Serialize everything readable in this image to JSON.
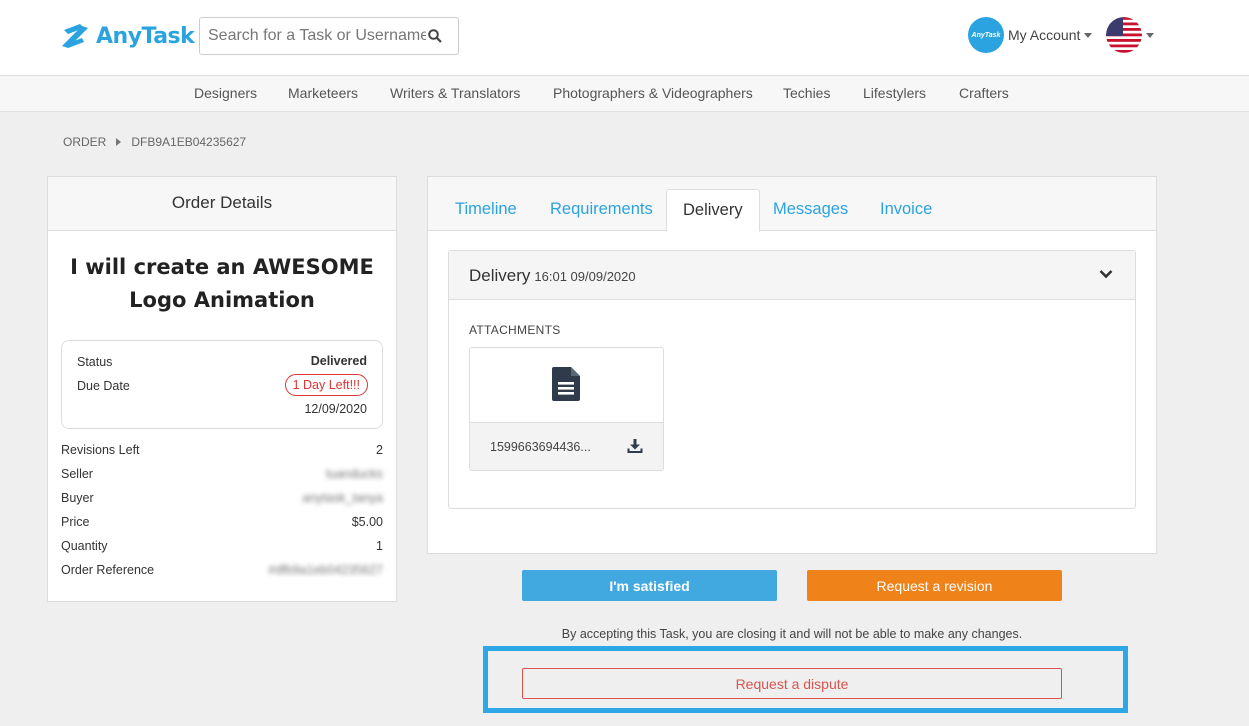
{
  "header": {
    "logo_text": "AnyTask",
    "search_placeholder": "Search for a Task or Username",
    "account_label": "My Account",
    "avatar_text": "AnyTask",
    "search_icon": "search-icon",
    "flag_icon": "us-flag-icon"
  },
  "categories": [
    "Designers",
    "Marketeers",
    "Writers & Translators",
    "Photographers & Videographers",
    "Techies",
    "Lifestylers",
    "Crafters"
  ],
  "breadcrumb": {
    "root": "ORDER",
    "current": "DFB9A1EB04235627"
  },
  "order_details": {
    "heading": "Order Details",
    "task_title": "I will create an AWESOME Logo Animation",
    "status_label": "Status",
    "status_value": "Delivered",
    "due_label": "Due Date",
    "due_badge": "1 Day Left!!!",
    "due_date": "12/09/2020",
    "rows": [
      {
        "label": "Revisions Left",
        "value": "2"
      },
      {
        "label": "Seller",
        "value": "tuanducks"
      },
      {
        "label": "Buyer",
        "value": "anytask_tanya"
      },
      {
        "label": "Price",
        "value": "$5.00"
      },
      {
        "label": "Quantity",
        "value": "1"
      },
      {
        "label": "Order Reference",
        "value": "#dfb9a1eb04235627"
      }
    ]
  },
  "tabs": [
    "Timeline",
    "Requirements",
    "Delivery",
    "Messages",
    "Invoice"
  ],
  "active_tab": "Delivery",
  "delivery": {
    "title": "Delivery",
    "timestamp": "16:01 09/09/2020",
    "attachments_label": "ATTACHMENTS",
    "file_name": "1599663694436...",
    "file_icon": "document-icon",
    "download_icon": "download-icon"
  },
  "actions": {
    "satisfied_label": "I'm satisfied",
    "revision_label": "Request a revision",
    "notice": "By accepting this Task, you are closing it and will not be able to make any changes.",
    "dispute_label": "Request a dispute"
  },
  "colors": {
    "brand": "#2aa3e0",
    "satisfied": "#42a9e0",
    "revision": "#f0821a",
    "dispute": "#d9534f",
    "highlight": "#2ea7e6"
  }
}
